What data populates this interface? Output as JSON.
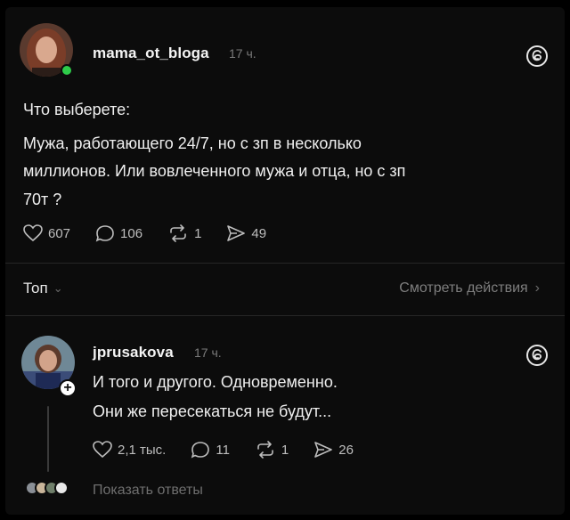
{
  "post": {
    "username": "mama_ot_bloga",
    "time": "17 ч.",
    "lines": [
      "Что выберете:",
      "Мужа, работающего 24/7, но с зп в несколько",
      "миллионов. Или вовлеченного мужа и отца, но с зп",
      "70т ?"
    ],
    "likes": "607",
    "comments": "106",
    "reposts": "1",
    "shares": "49"
  },
  "sort": {
    "label": "Топ",
    "activity_label": "Смотреть действия"
  },
  "reply": {
    "username": "jprusakova",
    "time": "17 ч.",
    "lines": [
      "И того и другого. Одновременно.",
      "Они же пересекаться не будут..."
    ],
    "likes": "2,1 тыс.",
    "comments": "11",
    "reposts": "1",
    "shares": "26",
    "show_replies": "Показать ответы"
  },
  "colors": {
    "background": "#0c0c0c",
    "online": "#2ecc4a",
    "text": "#efefef",
    "muted": "#7b7b7b"
  },
  "icons": [
    "heart-icon",
    "comment-icon",
    "repost-icon",
    "share-icon",
    "threads-logo-icon",
    "chevron-down-icon",
    "chevron-right-icon",
    "plus-icon"
  ]
}
